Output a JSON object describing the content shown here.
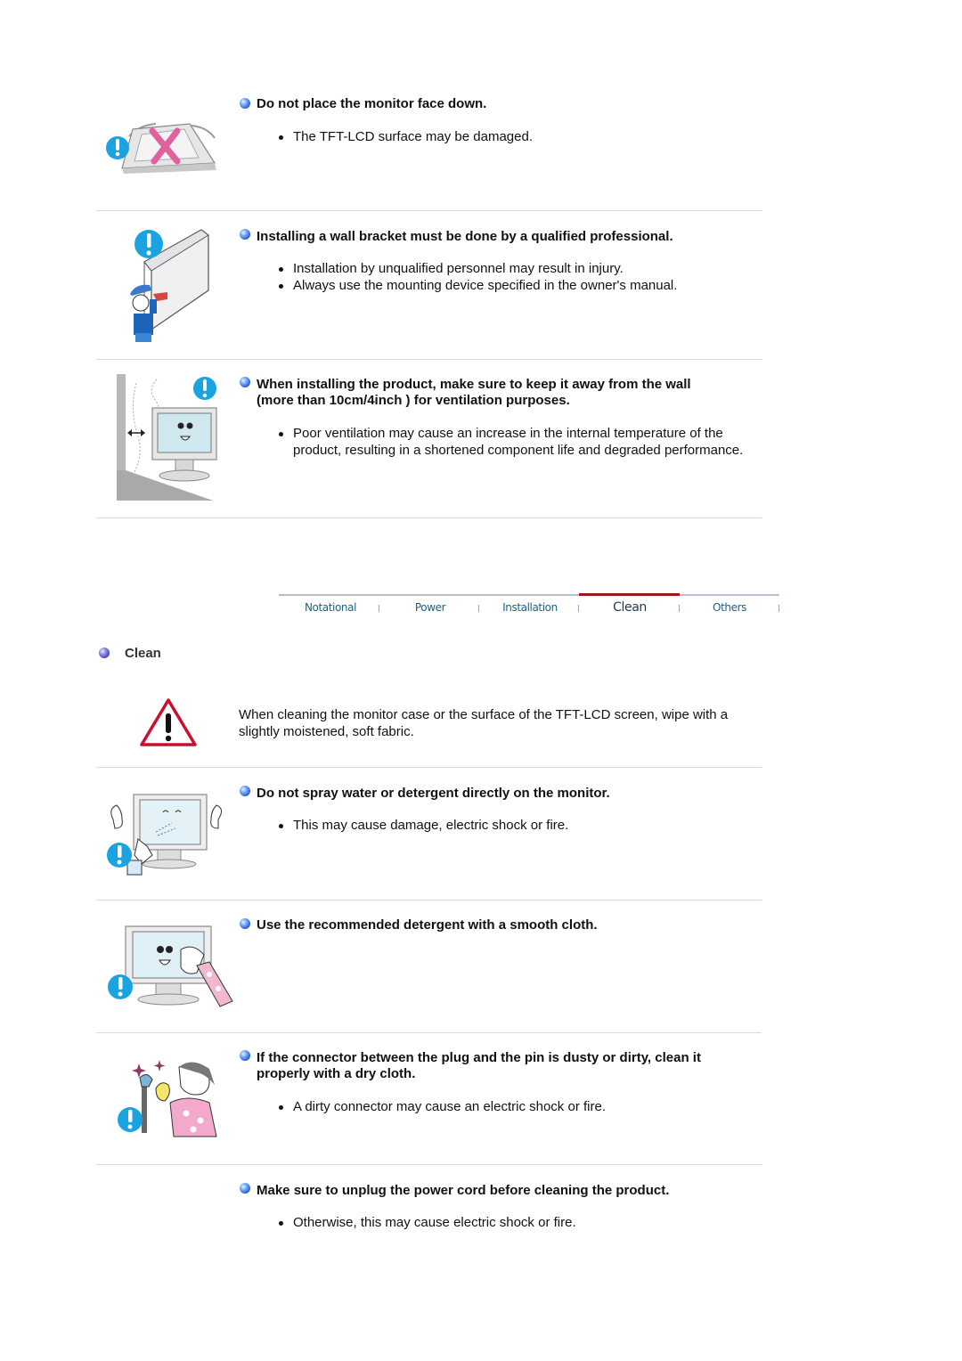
{
  "sections_top": [
    {
      "heading": "Do not place the monitor face down.",
      "items": [
        "The TFT-LCD surface may be damaged."
      ]
    },
    {
      "heading": "Installing a wall bracket must be done by a qualified professional.",
      "items": [
        "Installation by unqualified personnel may result in injury.",
        "Always use the mounting device specified in the owner's manual."
      ]
    },
    {
      "heading_line1": "When installing the product, make sure to keep it away from the wall",
      "heading_line2": "(more than 10cm/4inch ) for ventilation purposes.",
      "items": [
        "Poor ventilation may cause an increase in the internal temperature of the product, resulting in a shortened component life and degraded performance."
      ]
    }
  ],
  "tabs": [
    {
      "label": "Notational",
      "active": false
    },
    {
      "label": "Power",
      "active": false
    },
    {
      "label": "Installation",
      "active": false
    },
    {
      "label": "Clean",
      "active": true
    },
    {
      "label": "Others",
      "active": false
    }
  ],
  "colors": {
    "tab_active_bar": "#a0151c",
    "tab_bar": "#b8c0c4",
    "tab_bar_right": "#c9b8d8",
    "tab_text": "#1f5f80",
    "divider": "#dcdcdc",
    "warning_blue": "#1aa3e0",
    "warning_red": "#c8102e"
  },
  "clean": {
    "title": "Clean",
    "intro": "When cleaning the monitor case or the surface of the TFT-LCD screen, wipe with a slightly moistened, soft fabric.",
    "sections": [
      {
        "heading": "Do not spray water or detergent directly on the monitor.",
        "items": [
          "This may cause damage, electric shock or fire."
        ]
      },
      {
        "heading": "Use the recommended detergent with a smooth cloth.",
        "items": []
      },
      {
        "heading_line1": "If the connector between the plug and the pin is dusty or dirty, clean it",
        "heading_line2": "properly with a dry cloth.",
        "items": [
          "A dirty connector may cause an electric shock or fire."
        ]
      },
      {
        "heading": "Make sure to unplug the power cord before cleaning the product.",
        "items": [
          "Otherwise, this may cause electric shock or fire."
        ]
      }
    ]
  }
}
